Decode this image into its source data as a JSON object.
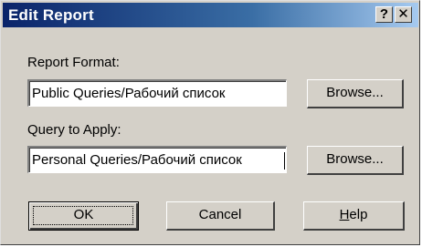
{
  "window": {
    "title": "Edit Report",
    "help_glyph": "?",
    "close_glyph": "✕"
  },
  "report_format": {
    "label": "Report Format:",
    "value": "Public Queries/Рабочий список",
    "browse_label": "Browse..."
  },
  "query_to_apply": {
    "label": "Query to Apply:",
    "value": "Personal Queries/Рабочий список",
    "browse_label": "Browse..."
  },
  "buttons": {
    "ok": "OK",
    "cancel": "Cancel",
    "help_accel": "H",
    "help_rest": "elp"
  }
}
